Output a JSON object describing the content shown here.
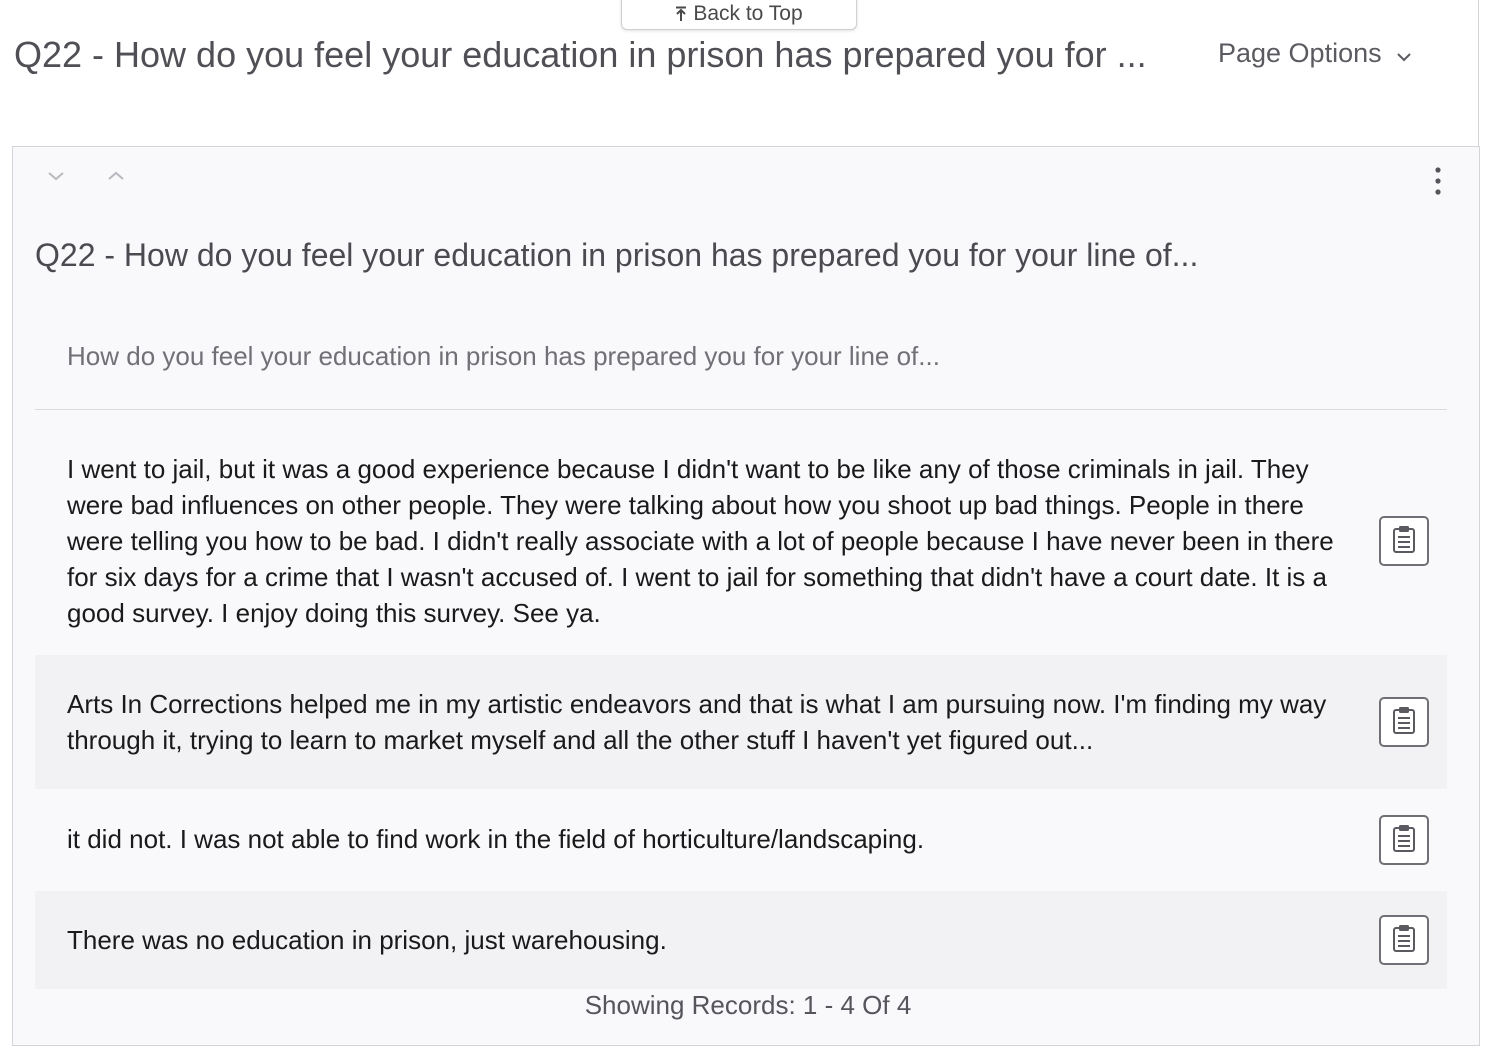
{
  "back_to_top": {
    "label": "Back to Top"
  },
  "header": {
    "title": "Q22 - How do you feel your education in prison has prepared you for ...",
    "page_options_label": "Page Options"
  },
  "card": {
    "title": "Q22 - How do you feel your education in prison has prepared you for your line of...",
    "question_text": "How do you feel your education in prison has prepared you for your line of..."
  },
  "responses": [
    {
      "text": "I went to jail, but it was a good experience because I didn't want to be like any of those criminals in jail. They were bad influences on other people. They were talking about how you shoot up bad things. People in there were telling you how to be bad. I didn't really associate with a lot of people because I have never been in there for six days for a crime that I wasn't accused of. I went to jail for something that didn't have a court date. It is a good survey. I enjoy doing this survey. See ya."
    },
    {
      "text": "Arts In Corrections helped me in my artistic endeavors and that is what I am pursuing now. I'm finding my way through it, trying to learn to market myself and all the other stuff I haven't yet figured out..."
    },
    {
      "text": "it did not. I was not able to find work in the field of horticulture/landscaping."
    },
    {
      "text": "There was no education in prison, just warehousing."
    }
  ],
  "footer": {
    "records_label": "Showing Records: 1 - 4 Of 4"
  },
  "icons": [
    "arrow-to-top-icon",
    "chevron-down-icon",
    "chevron-up-icon",
    "kebab-menu-icon",
    "clipboard-icon"
  ]
}
